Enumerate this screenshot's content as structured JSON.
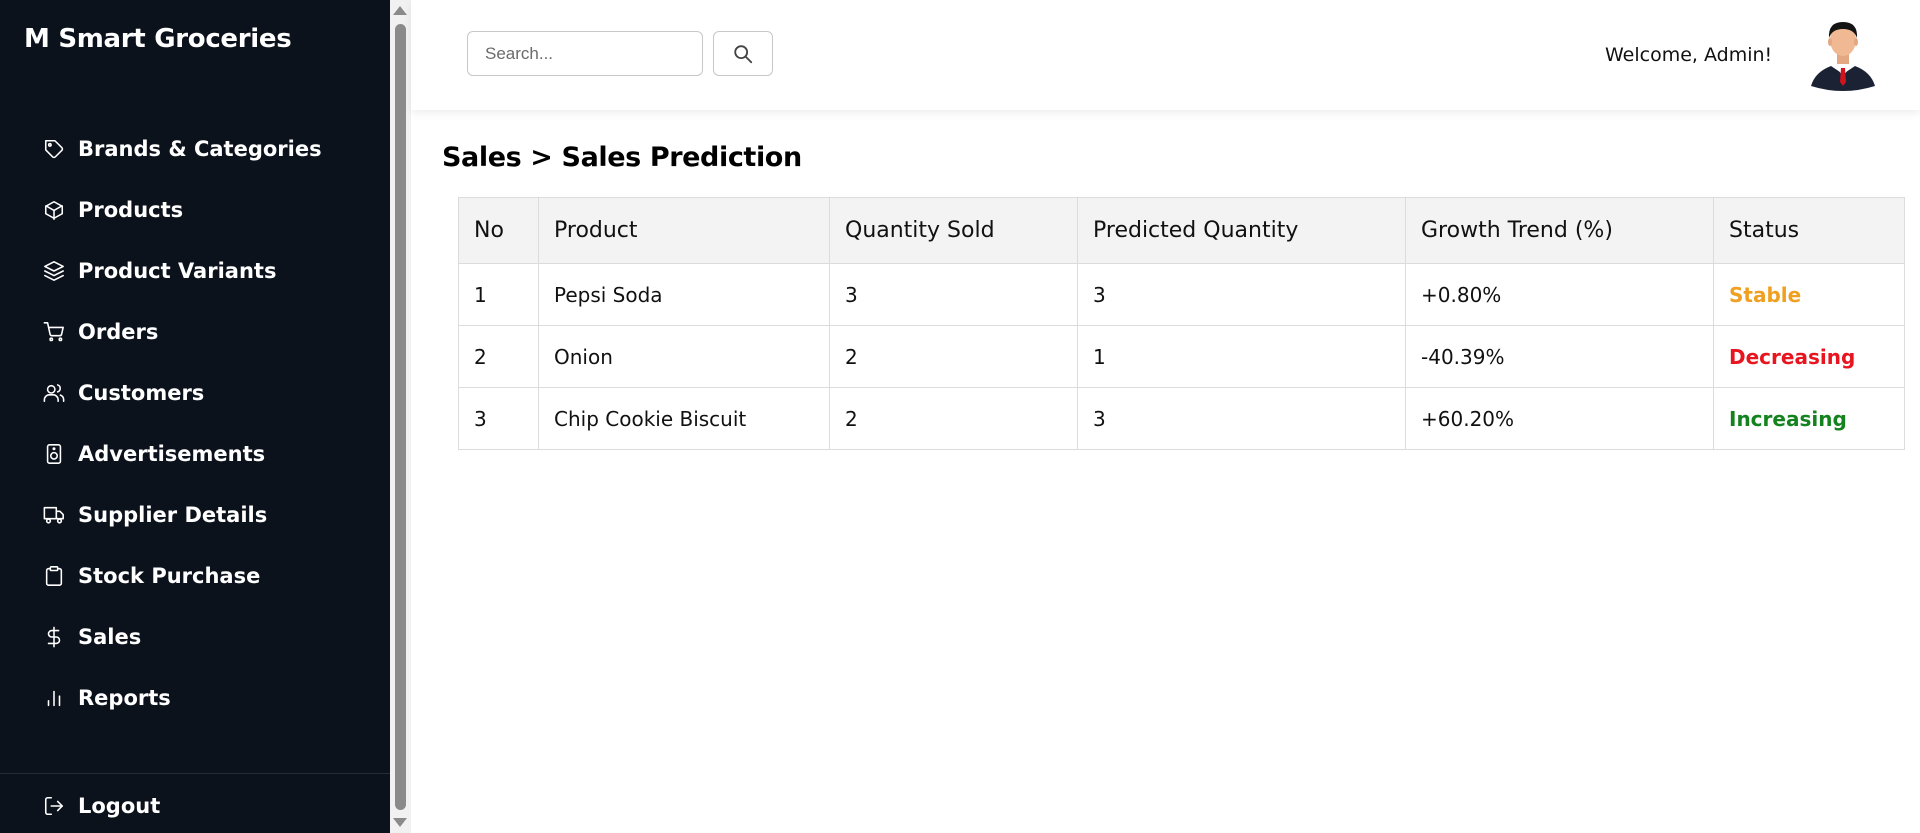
{
  "brand": {
    "title": "M Smart Groceries"
  },
  "nav": {
    "items": [
      {
        "label": "Brands & Categories",
        "icon": "tag-icon"
      },
      {
        "label": "Products",
        "icon": "box-icon"
      },
      {
        "label": "Product Variants",
        "icon": "layers-icon"
      },
      {
        "label": "Orders",
        "icon": "cart-icon"
      },
      {
        "label": "Customers",
        "icon": "users-icon"
      },
      {
        "label": "Advertisements",
        "icon": "speaker-icon"
      },
      {
        "label": "Supplier Details",
        "icon": "truck-icon"
      },
      {
        "label": "Stock Purchase",
        "icon": "clipboard-icon"
      },
      {
        "label": "Sales",
        "icon": "dollar-icon"
      },
      {
        "label": "Reports",
        "icon": "bar-chart-icon"
      }
    ],
    "logout": {
      "label": "Logout",
      "icon": "logout-icon"
    }
  },
  "header": {
    "search": {
      "placeholder": "Search...",
      "value": ""
    },
    "welcome": "Welcome, Admin!"
  },
  "main": {
    "title": "Sales > Sales Prediction",
    "table": {
      "headers": [
        "No",
        "Product",
        "Quantity Sold",
        "Predicted Quantity",
        "Growth Trend (%)",
        "Status"
      ],
      "rows": [
        {
          "no": "1",
          "product": "Pepsi Soda",
          "sold": "3",
          "predicted": "3",
          "trend": "+0.80%",
          "status": "Stable"
        },
        {
          "no": "2",
          "product": "Onion",
          "sold": "2",
          "predicted": "1",
          "trend": "-40.39%",
          "status": "Decreasing"
        },
        {
          "no": "3",
          "product": "Chip Cookie Biscuit",
          "sold": "2",
          "predicted": "3",
          "trend": "+60.20%",
          "status": "Increasing"
        }
      ]
    }
  },
  "colors": {
    "sidebar_bg": "#0c121c",
    "stable": "#f0a020",
    "decreasing": "#e8141e",
    "increasing": "#14821e"
  }
}
